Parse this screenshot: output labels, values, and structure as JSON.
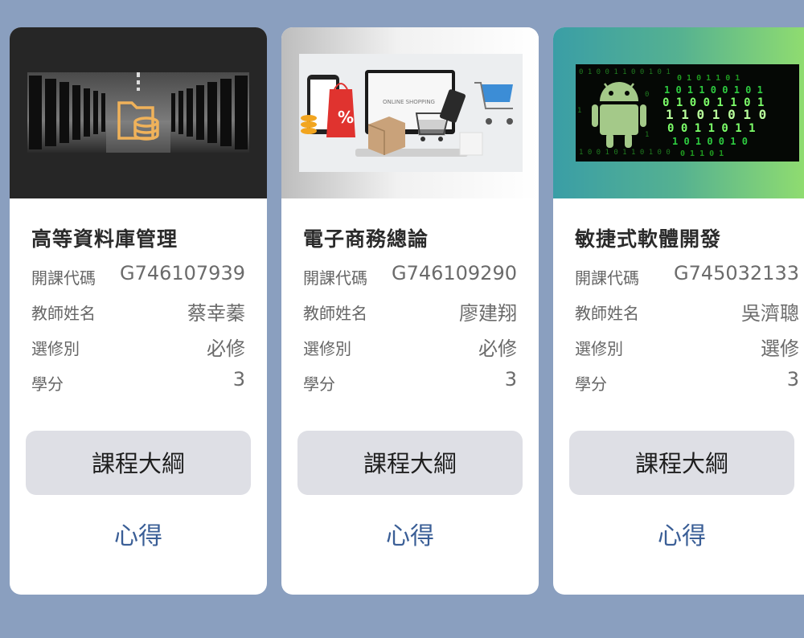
{
  "courses": [
    {
      "title": "高等資料庫管理",
      "code_label": "開課代碼",
      "code": "G746107939",
      "teacher_label": "教師姓名",
      "teacher": "蔡幸蓁",
      "type_label": "選修別",
      "type": "必修",
      "credit_label": "學分",
      "credit": "3",
      "syllabus_label": "課程大綱",
      "notes_label": "心得",
      "image": "server-room-database-icon"
    },
    {
      "title": "電子商務總論",
      "code_label": "開課代碼",
      "code": "G746109290",
      "teacher_label": "教師姓名",
      "teacher": "廖建翔",
      "type_label": "選修別",
      "type": "必修",
      "credit_label": "學分",
      "credit": "3",
      "syllabus_label": "課程大綱",
      "notes_label": "心得",
      "image": "online-shopping-illustration",
      "image_text": "ONLINE SHOPPING",
      "image_badge": "%"
    },
    {
      "title": "敏捷式軟體開發",
      "code_label": "開課代碼",
      "code": "G745032133",
      "teacher_label": "教師姓名",
      "teacher": "吳濟聰",
      "type_label": "選修別",
      "type": "選修",
      "credit_label": "學分",
      "credit": "3",
      "syllabus_label": "課程大綱",
      "notes_label": "心得",
      "image": "android-binary-globe-icon"
    }
  ],
  "colors": {
    "background": "#8a9fbf",
    "button": "#dedfe5",
    "link": "#3a5e96",
    "database_icon": "#f0b25a",
    "android": "#a4c989",
    "binary": "#2ecc40"
  }
}
